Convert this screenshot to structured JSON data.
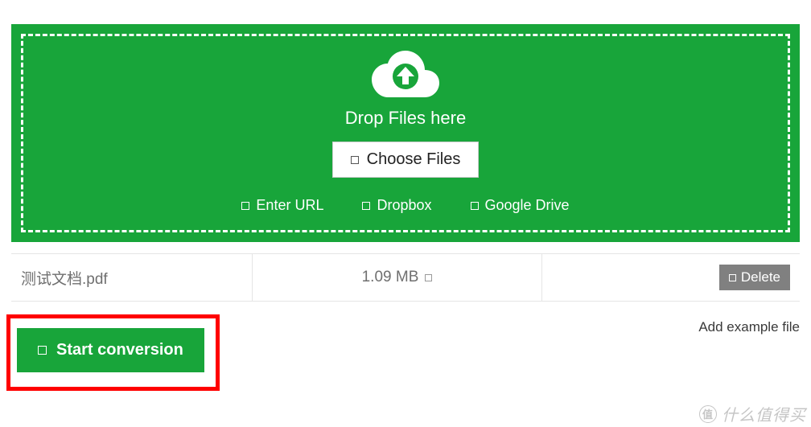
{
  "dropzone": {
    "title": "Drop Files here",
    "choose_label": "Choose Files",
    "sources": {
      "enter_url": "Enter URL",
      "dropbox": "Dropbox",
      "google_drive": "Google Drive"
    }
  },
  "file": {
    "name": "测试文档.pdf",
    "size": "1.09 MB",
    "delete_label": "Delete"
  },
  "actions": {
    "start_label": "Start conversion",
    "example_label": "Add example file"
  },
  "watermark": {
    "badge": "值",
    "text": "什么值得买"
  }
}
